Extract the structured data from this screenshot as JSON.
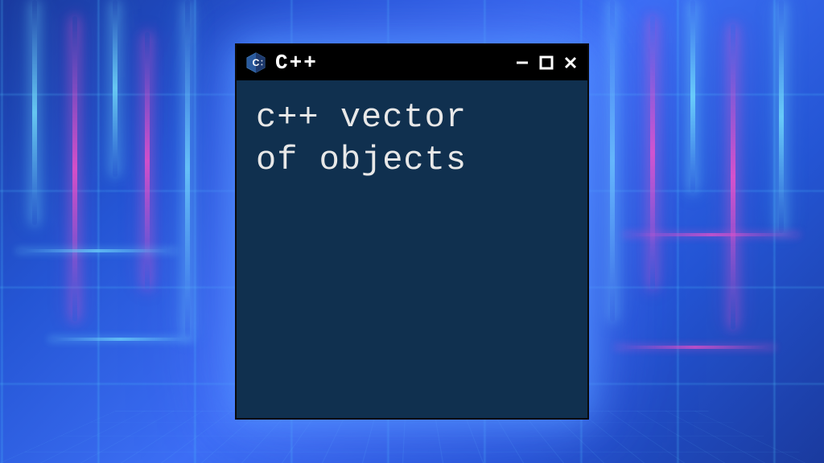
{
  "window": {
    "title": "C++",
    "icon_name": "cpp-icon",
    "controls": {
      "minimize": "−",
      "maximize": "▢",
      "close": "✕"
    }
  },
  "content": {
    "text": "c++ vector\nof objects"
  },
  "colors": {
    "titlebar_bg": "#000000",
    "content_bg": "#10304f",
    "text": "#e8e8e8",
    "glow_cyan": "#78e6ff",
    "glow_pink": "#ff50c8"
  }
}
